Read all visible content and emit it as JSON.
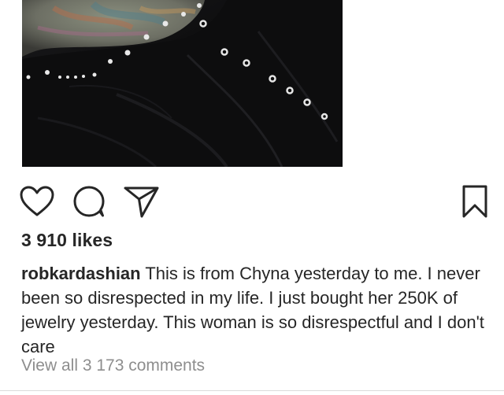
{
  "post": {
    "photo": {
      "icon": "post-photo"
    },
    "actions": {
      "like_icon": "heart-icon",
      "comment_icon": "comment-icon",
      "share_icon": "share-icon",
      "save_icon": "bookmark-icon"
    },
    "likes": "3 910 likes",
    "caption": {
      "username": "robkardashian",
      "text": "This is from Chyna yesterday to me. I never been so disrespected in my life. I just bought her 250K of jewelry yesterday. This woman is so disrespectful and I don't care"
    },
    "view_comments": "View all 3 173 comments"
  },
  "colors": {
    "text": "#262626",
    "muted": "#8e8e8e",
    "photo_bg": "#0e0e0f"
  }
}
